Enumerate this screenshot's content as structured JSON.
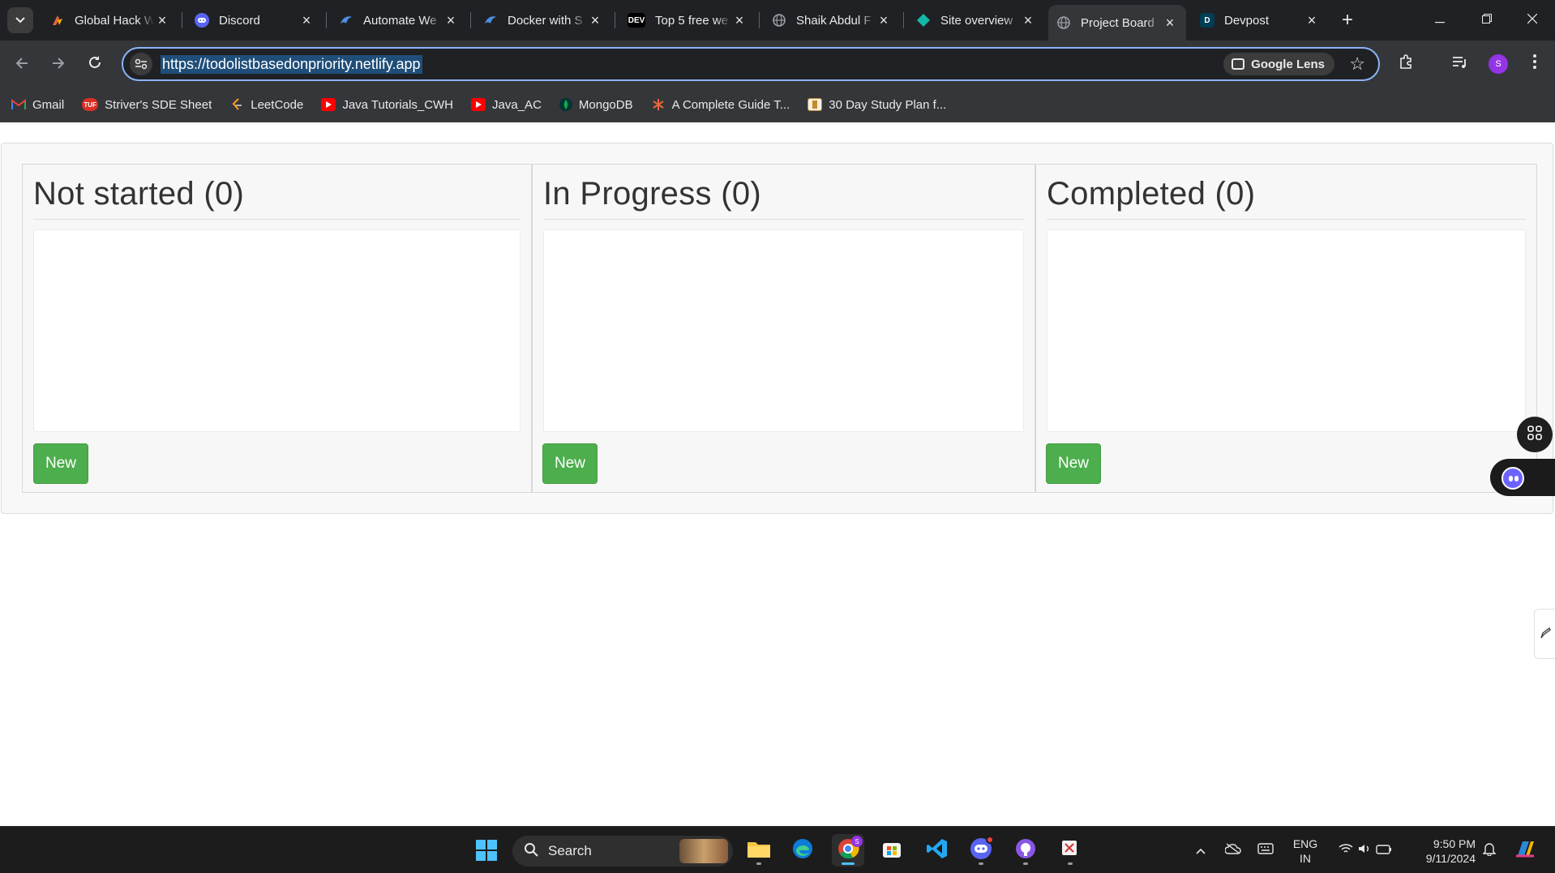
{
  "browser": {
    "tabs": [
      {
        "title": "Global Hack W",
        "icon": "global-hack-favicon",
        "color": "#e8663d"
      },
      {
        "title": "Discord",
        "icon": "discord-favicon",
        "color": "#5865f2"
      },
      {
        "title": "Automate We",
        "icon": "automate-favicon",
        "color": "#4a90e2"
      },
      {
        "title": "Docker with S",
        "icon": "docker-favicon",
        "color": "#4a90e2"
      },
      {
        "title": "Top 5 free we",
        "icon": "dev-favicon",
        "color": "#000000"
      },
      {
        "title": "Shaik Abdul F",
        "icon": "globe-favicon",
        "color": "#9aa0a6"
      },
      {
        "title": "Site overview",
        "icon": "netlify-favicon",
        "color": "#14b8a6"
      },
      {
        "title": "Project Board",
        "icon": "globe-favicon",
        "color": "#9aa0a6"
      },
      {
        "title": "Devpost",
        "icon": "devpost-favicon",
        "color": "#003e54"
      }
    ],
    "dev_badge": "DEV",
    "devpost_badge": "D",
    "url": "https://todolistbasedonpriority.netlify.app",
    "google_lens_label": "Google Lens",
    "profile_initial": "S",
    "bookmarks": [
      {
        "label": "Gmail",
        "icon": "gmail-icon",
        "color": "#ea4335"
      },
      {
        "label": "Striver's SDE Sheet",
        "icon": "tuf-icon",
        "color": "#d93025"
      },
      {
        "label": "LeetCode",
        "icon": "leetcode-icon",
        "color": "#ffa116"
      },
      {
        "label": "Java Tutorials_CWH",
        "icon": "youtube-icon",
        "color": "#ff0000"
      },
      {
        "label": "Java_AC",
        "icon": "youtube-icon",
        "color": "#ff0000"
      },
      {
        "label": "MongoDB",
        "icon": "mongodb-icon",
        "color": "#00684a"
      },
      {
        "label": "A Complete Guide T...",
        "icon": "asterisk-icon",
        "color": "#e8663d"
      },
      {
        "label": "30 Day Study Plan f...",
        "icon": "book-icon",
        "color": "#c58a2c"
      }
    ],
    "tuf_badge": "TUF"
  },
  "board": {
    "columns": [
      {
        "title": "Not started (0)",
        "new_label": "New"
      },
      {
        "title": "In Progress (0)",
        "new_label": "New"
      },
      {
        "title": "Completed (0)",
        "new_label": "New"
      }
    ],
    "accent_color": "#4cae4c"
  },
  "taskbar": {
    "search_label": "Search",
    "language": "ENG",
    "region": "IN",
    "time": "9:50 PM",
    "date": "9/11/2024",
    "chrome_badge": "S"
  }
}
